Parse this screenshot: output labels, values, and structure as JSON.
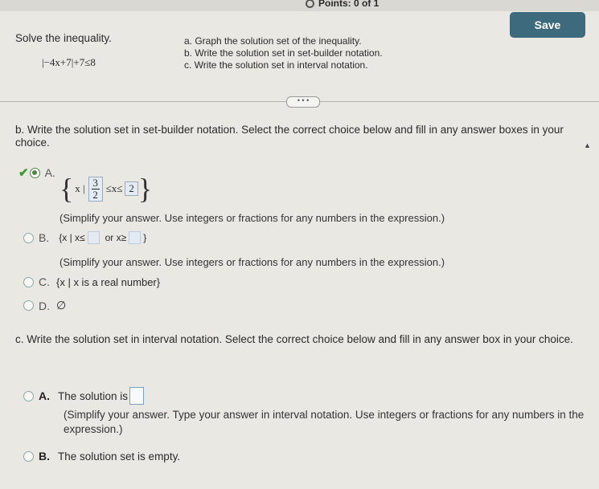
{
  "header": {
    "points_label": "Points: 0 of 1",
    "save_label": "Save"
  },
  "problem": {
    "instruction": "Solve the inequality.",
    "inequality": "|−4x+7|+7≤8",
    "tasks": [
      "a. Graph the solution set of the inequality.",
      "b. Write the solution set in set-builder notation.",
      "c. Write the solution set in interval notation."
    ]
  },
  "divider": {
    "expand_label": "• • •"
  },
  "part_b": {
    "prompt": "b. Write the solution set in set-builder notation. Select the correct choice below and fill in any answer boxes in your choice.",
    "option_a": {
      "letter": "A.",
      "prefix": "x |",
      "numerator": "3",
      "denominator": "2",
      "middle": "≤x≤",
      "upper_value": "2",
      "hint": "(Simplify your answer. Use integers or fractions for any numbers in the expression.)",
      "selected": true
    },
    "option_b": {
      "letter": "B.",
      "part1": "{x | x≤",
      "part2": "or x≥",
      "part3": "}",
      "hint": "(Simplify your answer. Use integers or fractions for any numbers in the expression.)"
    },
    "option_c": {
      "letter": "C.",
      "text": "{x | x is a real number}"
    },
    "option_d": {
      "letter": "D.",
      "text": "∅"
    }
  },
  "part_c": {
    "prompt": "c. Write the solution set in interval notation. Select the correct choice below and fill in any answer box in your choice.",
    "option_a": {
      "letter": "A.",
      "text": "The solution is",
      "hint": "(Simplify your answer. Type your answer in interval notation. Use integers or fractions for any numbers in the expression.)"
    },
    "option_b": {
      "letter": "B.",
      "text": "The solution set is empty."
    }
  }
}
